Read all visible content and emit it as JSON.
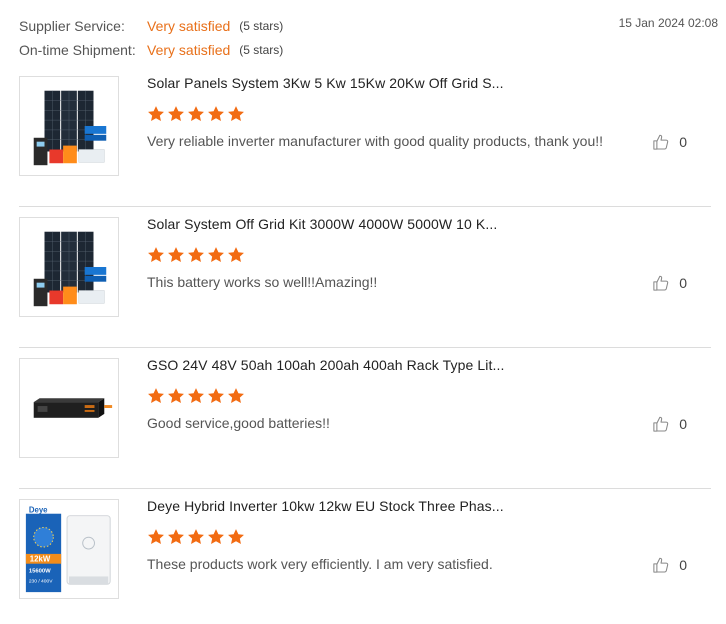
{
  "ratings": {
    "supplier_service": {
      "label": "Supplier Service:",
      "value": "Very satisfied",
      "stars": "(5 stars)"
    },
    "ontime_shipment": {
      "label": "On-time Shipment:",
      "value": "Very satisfied",
      "stars": "(5 stars)"
    }
  },
  "timestamp": "15 Jan 2024 02:08",
  "colors": {
    "accent": "#e8701a",
    "star": "#f26b12",
    "divider": "#dcdcdc"
  },
  "reviews": [
    {
      "title": "Solar Panels System 3Kw 5 Kw 15Kw 20Kw Off Grid S...",
      "rating": 5,
      "comment": "Very reliable inverter manufacturer with good quality products, thank you!!",
      "likes": "0",
      "image": "solar-system-kit"
    },
    {
      "title": "Solar System Off Grid Kit 3000W 4000W 5000W 10 K...",
      "rating": 5,
      "comment": "This battery works so well!!Amazing!!",
      "likes": "0",
      "image": "solar-system-kit"
    },
    {
      "title": "GSO 24V 48V 50ah 100ah 200ah 400ah Rack Type Lit...",
      "rating": 5,
      "comment": "Good service,good batteries!!",
      "likes": "0",
      "image": "rack-battery"
    },
    {
      "title": "Deye Hybrid Inverter 10kw 12kw EU Stock Three Phas...",
      "rating": 5,
      "comment": "These products work very efficiently. I am very satisfied.",
      "likes": "0",
      "image": "hybrid-inverter",
      "image_text": {
        "brand": "Deye",
        "power": "12kW",
        "pv": "15600W",
        "voltage": "230 / 400V"
      }
    }
  ],
  "icons": {
    "star": "star-icon",
    "like": "thumbs-up-icon"
  }
}
